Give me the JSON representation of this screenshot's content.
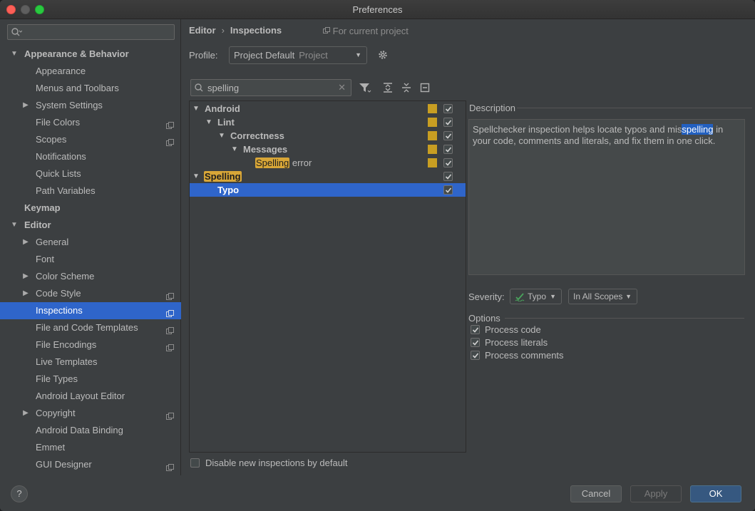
{
  "window": {
    "title": "Preferences"
  },
  "sidebar": {
    "search_placeholder": "",
    "items": [
      {
        "label": "Appearance & Behavior",
        "expanded": true
      },
      {
        "label": "Appearance"
      },
      {
        "label": "Menus and Toolbars"
      },
      {
        "label": "System Settings",
        "expanded": false
      },
      {
        "label": "File Colors"
      },
      {
        "label": "Scopes"
      },
      {
        "label": "Notifications"
      },
      {
        "label": "Quick Lists"
      },
      {
        "label": "Path Variables"
      },
      {
        "label": "Keymap"
      },
      {
        "label": "Editor",
        "expanded": true
      },
      {
        "label": "General",
        "expanded": false
      },
      {
        "label": "Font"
      },
      {
        "label": "Color Scheme",
        "expanded": false
      },
      {
        "label": "Code Style",
        "expanded": false
      },
      {
        "label": "Inspections",
        "selected": true
      },
      {
        "label": "File and Code Templates"
      },
      {
        "label": "File Encodings"
      },
      {
        "label": "Live Templates"
      },
      {
        "label": "File Types"
      },
      {
        "label": "Android Layout Editor"
      },
      {
        "label": "Copyright",
        "expanded": false
      },
      {
        "label": "Android Data Binding"
      },
      {
        "label": "Emmet"
      },
      {
        "label": "GUI Designer"
      }
    ]
  },
  "header": {
    "breadcrumb": [
      "Editor",
      "Inspections"
    ],
    "breadcrumb_sep": "›",
    "for_project": "For current project",
    "profile_label": "Profile:",
    "profile_value": "Project Default",
    "profile_scope": "Project"
  },
  "filter": {
    "value": "spelling"
  },
  "inspections_tree": [
    {
      "label": "Android",
      "expanded": true
    },
    {
      "label": "Lint",
      "expanded": true
    },
    {
      "label": "Correctness",
      "expanded": true
    },
    {
      "label": "Messages",
      "expanded": true
    },
    {
      "highlight": "Spelling",
      "rest": " error"
    },
    {
      "label": "Spelling",
      "expanded": true,
      "highlighted": true
    },
    {
      "label": "Typo",
      "selected": true
    }
  ],
  "description": {
    "label": "Description",
    "text_before": "Spellchecker inspection helps locate typos and mis",
    "text_highlight": "spelling",
    "text_after": " in your code, comments and literals, and fix them in one click."
  },
  "severity": {
    "label": "Severity:",
    "value": "Typo",
    "scope": "In All Scopes"
  },
  "options": {
    "label": "Options",
    "items": [
      {
        "label": "Process code",
        "checked": true
      },
      {
        "label": "Process literals",
        "checked": true
      },
      {
        "label": "Process comments",
        "checked": true
      }
    ]
  },
  "disable_new": {
    "label": "Disable new inspections by default",
    "checked": false
  },
  "buttons": {
    "help": "?",
    "cancel": "Cancel",
    "apply": "Apply",
    "ok": "OK"
  },
  "colors": {
    "accent": "#2f65ca",
    "warning": "#c89e22",
    "ok_button": "#365880"
  }
}
